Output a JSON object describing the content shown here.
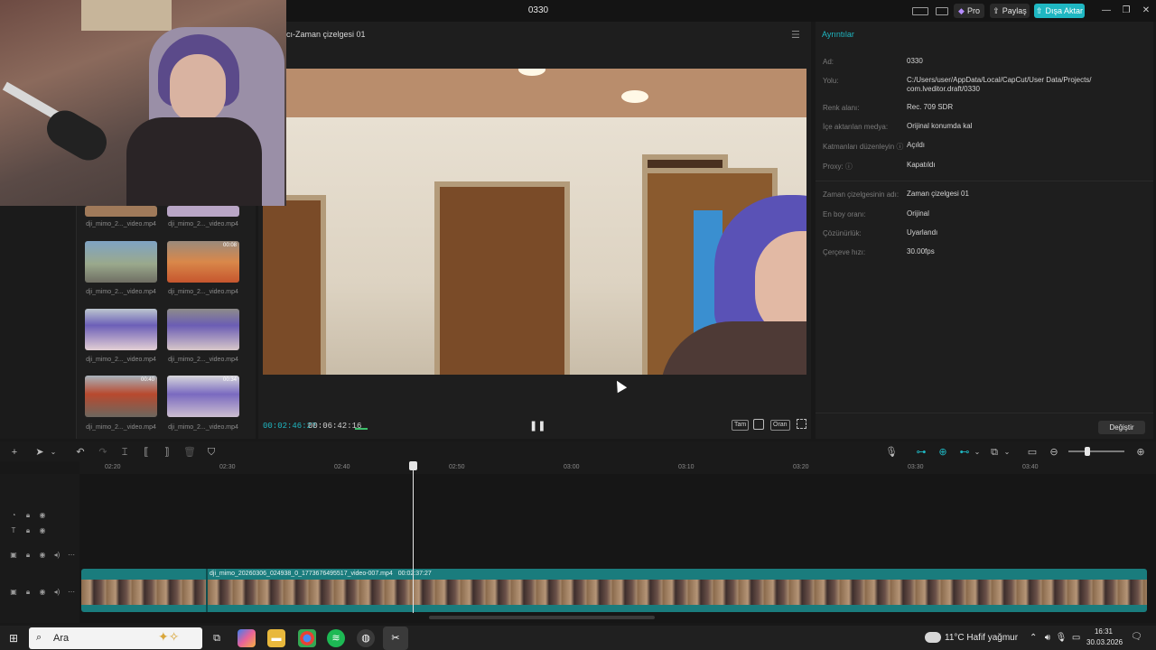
{
  "window": {
    "title": "0330",
    "pro_label": "Pro",
    "share_label": "Paylaş",
    "export_label": "Dışa Aktar",
    "minimize": "—",
    "maximize": "❐",
    "close": "✕"
  },
  "media": {
    "items": [
      {
        "label": "dji_mimo_2..._video.mp4",
        "duration": ""
      },
      {
        "label": "dji_mimo_2..._video.mp4",
        "duration": ""
      },
      {
        "label": "dji_mimo_2..._video.mp4",
        "duration": ""
      },
      {
        "label": "dji_mimo_2..._video.mp4",
        "duration": "00:08"
      },
      {
        "label": "dji_mimo_2..._video.mp4",
        "duration": ""
      },
      {
        "label": "dji_mimo_2..._video.mp4",
        "duration": ""
      },
      {
        "label": "dji_mimo_2..._video.mp4",
        "duration": "00:40"
      },
      {
        "label": "dji_mimo_2..._video.mp4",
        "duration": "00:34"
      }
    ]
  },
  "player": {
    "title": "cı-Zaman çizelgesi 01",
    "menu_icon": "hamburger-icon",
    "current_time": "00:02:46:27",
    "total_time": "00:06:42:16",
    "pause_icon": "❚❚",
    "full_label": "Tam",
    "ratio_label": "Oran"
  },
  "details": {
    "tab": "Ayrıntılar",
    "rows": [
      {
        "label": "Ad:",
        "value": "0330"
      },
      {
        "label": "Yolu:",
        "value": "C:/Users/user/AppData/Local/CapCut/User Data/Projects/ com.lveditor.draft/0330"
      },
      {
        "label": "Renk alanı:",
        "value": "Rec. 709 SDR"
      },
      {
        "label": "İçe aktarılan medya:",
        "value": "Orijinal konumda kal"
      },
      {
        "label": "Katmanları düzenleyin ⓘ",
        "value": "Açıldı"
      },
      {
        "label": "Proxy: ⓘ",
        "value": "Kapatıldı"
      },
      {
        "label": "Zaman çizelgesinin adı:",
        "value": "Zaman çizelgesi 01"
      },
      {
        "label": "En boy oranı:",
        "value": "Orijinal"
      },
      {
        "label": "Çözünürlük:",
        "value": "Uyarlandı"
      },
      {
        "label": "Çerçeve hızı:",
        "value": "30.00fps"
      }
    ],
    "change_button": "Değiştir"
  },
  "timeline": {
    "ticks": [
      "02:20",
      "02:30",
      "02:40",
      "02:50",
      "03:00",
      "03:10",
      "03:20",
      "03:30",
      "03:40"
    ],
    "clip_name": "dji_mimo_20260306_024938_0_1773676495517_video-007.mp4",
    "clip_duration": "00:02:37:27"
  },
  "taskbar": {
    "search_placeholder": "Ara",
    "weather": "11°C  Hafif yağmur",
    "time": "16:31",
    "date": "30.03.2026"
  },
  "colors": {
    "accent": "#1fb7c2",
    "clip": "#1a7c7d",
    "panel": "#1e1e1e"
  }
}
